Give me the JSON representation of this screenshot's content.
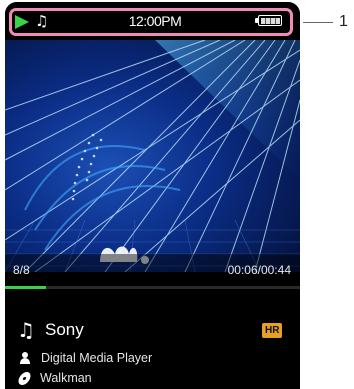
{
  "status_bar": {
    "play_icon": "play-icon",
    "music_icon": "♫",
    "time": "12:00PM",
    "battery_icon": "battery-icon"
  },
  "playback": {
    "track_position": "8/8",
    "time_display": "00:06/00:44",
    "progress": 0.14
  },
  "track": {
    "title": "Sony",
    "title_icon": "♫",
    "hires_badge": "HR",
    "artist": "Digital Media Player",
    "album": "Walkman"
  },
  "callout": {
    "number": "1"
  },
  "colors": {
    "accent_green": "#39d24a",
    "callout_pink": "#f08ab8",
    "hires_orange": "#e8a020",
    "background": "#000000"
  }
}
